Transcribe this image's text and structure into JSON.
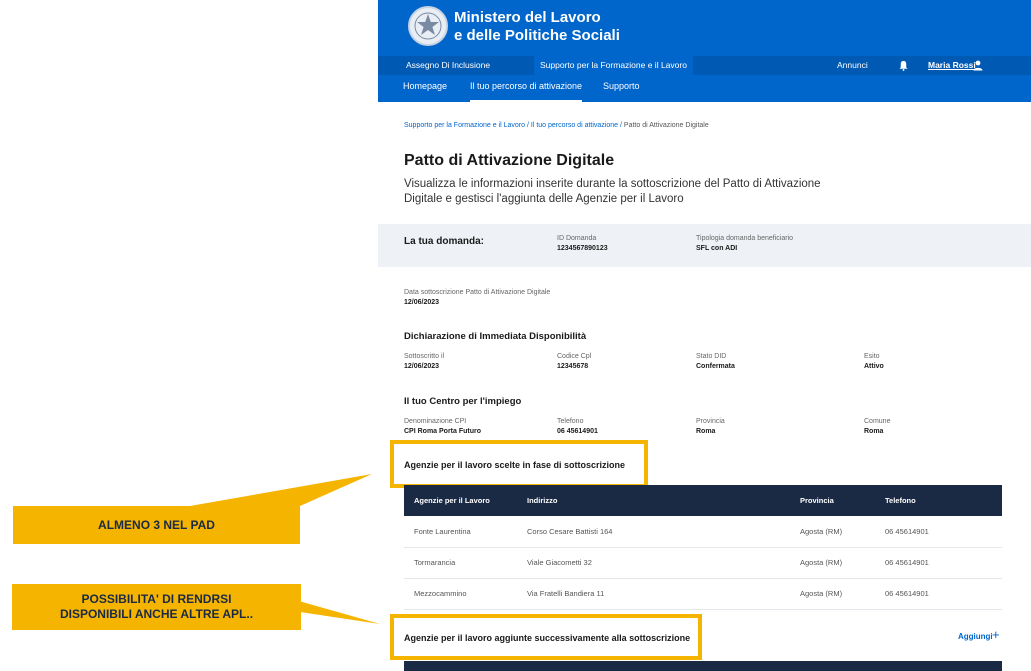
{
  "header": {
    "ministry_line1": "Ministero del Lavoro",
    "ministry_line2": "e delle Politiche Sociali",
    "tabs": [
      "Assegno Di Inclusione",
      "Supporto per la Formazione e il Lavoro"
    ],
    "annunci": "Annunci",
    "user": "Maria Rossi",
    "nav": [
      "Homepage",
      "Il tuo percorso di attivazione",
      "Supporto"
    ]
  },
  "breadcrumb": {
    "item1": "Supporto per la Formazione e il Lavoro",
    "sep": "/",
    "item2": "Il tuo percorso di attivazione",
    "current": "Patto di Attivazione Digitale"
  },
  "page": {
    "title": "Patto di Attivazione Digitale",
    "description": "Visualizza le informazioni inserite durante la sottoscrizione del Patto di Attivazione Digitale e gestisci l'aggiunta delle Agenzie per il Lavoro"
  },
  "summary": {
    "label": "La tua domanda:",
    "id_label": "ID Domanda",
    "id_value": "1234567890123",
    "tipologia_label": "Tipologia domanda beneficiario",
    "tipologia_value": "SFL con ADI"
  },
  "sottoscrizione": {
    "label": "Data sottoscrizione Patto di Attivazione Digitale",
    "value": "12/06/2023"
  },
  "did": {
    "title": "Dichiarazione di Immediata Disponibilità",
    "fields": [
      {
        "label": "Sottoscritto il",
        "value": "12/06/2023"
      },
      {
        "label": "Codice Cpl",
        "value": "12345678"
      },
      {
        "label": "Stato DID",
        "value": "Confermata"
      },
      {
        "label": "Esito",
        "value": "Attivo"
      }
    ]
  },
  "cpi": {
    "title": "Il tuo Centro per l'impiego",
    "fields": [
      {
        "label": "Denominazione CPI",
        "value": "CPI Roma Porta Futuro"
      },
      {
        "label": "Telefono",
        "value": "06 45614901"
      },
      {
        "label": "Provincia",
        "value": "Roma"
      },
      {
        "label": "Comune",
        "value": "Roma"
      }
    ]
  },
  "agenzie_scelte": {
    "title": "Agenzie per il lavoro scelte in fase di sottoscrizione",
    "headers": [
      "Agenzie per il Lavoro",
      "Indirizzo",
      "Provincia",
      "Telefono"
    ],
    "rows": [
      [
        "Fonte Laurentina",
        "Corso Cesare Battisti 164",
        "Agosta (RM)",
        "06 45614901"
      ],
      [
        "Tormarancia",
        "Viale Giacometti 32",
        "Agosta (RM)",
        "06 45614901"
      ],
      [
        "Mezzocammino",
        "Via Fratelli Bandiera 11",
        "Agosta (RM)",
        "06 45614901"
      ]
    ]
  },
  "agenzie_aggiunte": {
    "title": "Agenzie per il lavoro aggiunte successivamente alla sottoscrizione",
    "add_label": "Aggiungi",
    "add_icon": "plus-icon"
  },
  "annotations": {
    "callout1": "ALMENO 3 NEL PAD",
    "callout2_line1": "POSSIBILITA' DI RENDRSI",
    "callout2_line2": "DISPONIBILI ANCHE ALTRE APL..",
    "highlight_color": "#f5b400"
  },
  "colors": {
    "primary": "#0066cc",
    "table_header": "#1a2a44",
    "summary_bg": "#eef2f7"
  }
}
